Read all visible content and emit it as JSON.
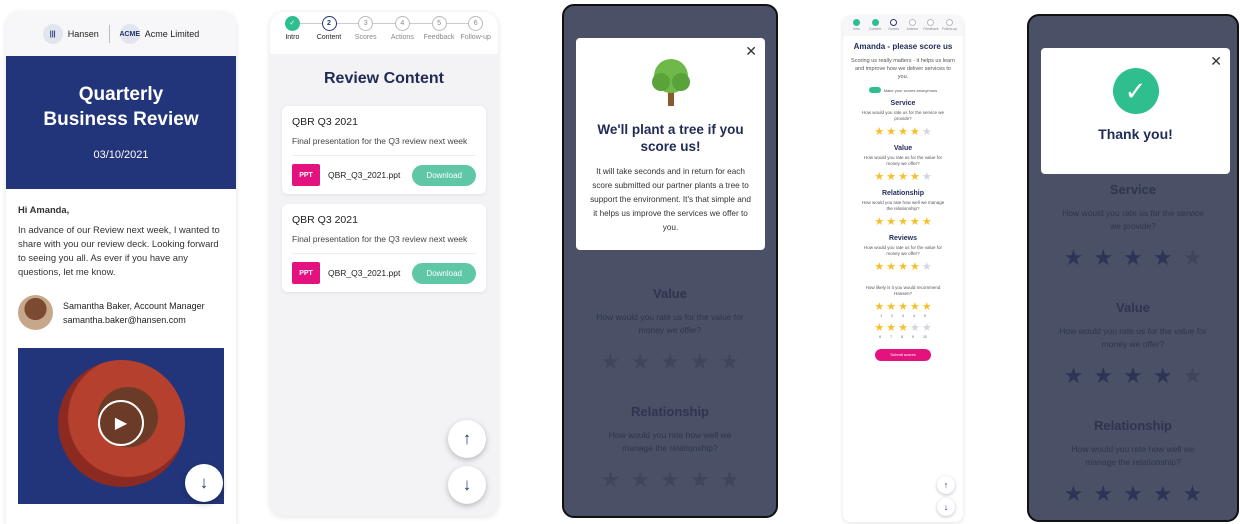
{
  "screen1": {
    "brand1": "Hansen",
    "brand2": "Acme Limited",
    "brand2_logo": "ACME",
    "title_line1": "Quarterly",
    "title_line2": "Business Review",
    "date": "03/10/2021",
    "greeting": "Hi Amanda,",
    "message": "In advance of our Review next week, I wanted to share with you our review deck. Looking forward to seeing you all. As ever if you have any questions, let me know.",
    "sender_name": "Samantha Baker, Account Manager",
    "sender_email": "samantha.baker@hansen.com"
  },
  "screen2": {
    "steps": [
      "Intro",
      "Content",
      "Scores",
      "Actions",
      "Feedback",
      "Follow-up"
    ],
    "step_nums": [
      "✓",
      "2",
      "3",
      "4",
      "5",
      "6"
    ],
    "title": "Review Content",
    "cards": [
      {
        "title": "QBR Q3 2021",
        "desc": "Final presentation for the Q3 review next week",
        "badge": "PPT",
        "file": "QBR_Q3_2021.ppt",
        "button": "Download"
      },
      {
        "title": "QBR Q3 2021",
        "desc": "Final presentation for the Q3 review next week",
        "badge": "PPT",
        "file": "QBR_Q3_2021.ppt",
        "button": "Download"
      }
    ]
  },
  "screen3": {
    "modal_title": "We'll plant a tree if you score us!",
    "modal_text": "It will take seconds and in return for each score submitted our partner plants a tree to support the environment. It's that simple and it helps us improve the services we offer to you.",
    "value_title": "Value",
    "value_q": "How would you rate us for the value for money we offer?",
    "rel_title": "Relationship",
    "rel_q": "How would you rate how well we manage the relationship?"
  },
  "screen4": {
    "title": "Amanda - please score us",
    "subtitle": "Scoring us really matters - it helps us learn and improve how we deliver services to you.",
    "toggle": "Make your scores anonymous",
    "sections": [
      {
        "h": "Service",
        "q": "How would you rate us for the service we provide?",
        "rating": 4
      },
      {
        "h": "Value",
        "q": "How would you rate us for the value for money we offer?",
        "rating": 4
      },
      {
        "h": "Relationship",
        "q": "How would you rate how well we manage the relationship?",
        "rating": 5
      },
      {
        "h": "Reviews",
        "q": "How would you rate us for the value for money we offer?",
        "rating": 4
      }
    ],
    "recommend_q": "How likely is it you would recommend Hansen?",
    "nps_row1": [
      "1",
      "2",
      "3",
      "4",
      "5"
    ],
    "nps_row2": [
      "6",
      "7",
      "8",
      "9",
      "10"
    ],
    "nps_rating": 8,
    "submit": "Submit scores"
  },
  "screen5": {
    "modal_title": "Thank you!",
    "service_title": "Service",
    "service_q": "How would you rate us for the service we provide?",
    "value_title": "Value",
    "value_q": "How would you rate us for the value for money we offer?",
    "rel_title": "Relationship",
    "rel_q": "How would you rate how well we manage the relationship?"
  },
  "colors": {
    "navy": "#22357a",
    "green": "#2fbf8f",
    "pink": "#e3127f",
    "teal": "#5fc6a6",
    "star": "#f6c02b"
  }
}
